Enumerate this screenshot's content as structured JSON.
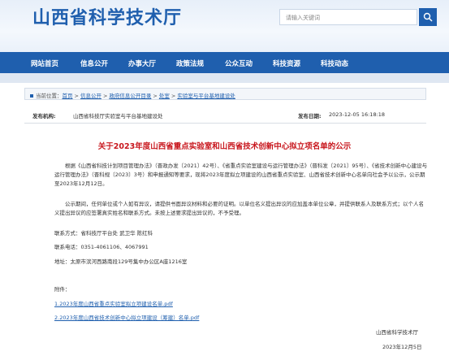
{
  "site": {
    "title": "山西省科学技术厅"
  },
  "search": {
    "placeholder": "请输入关键词"
  },
  "nav": {
    "items": [
      "网站首页",
      "信息公开",
      "办事大厅",
      "政策法规",
      "公众互动",
      "科技资源",
      "科技动态"
    ]
  },
  "breadcrumb": {
    "prefix": "当前位置：",
    "items": [
      "首页",
      "信息公开",
      "政府信息公开目录",
      "处室",
      "实验室与平台基地建设处"
    ]
  },
  "meta": {
    "agency_label": "发布机构:",
    "agency_value": "山西省科技厅实验室与平台基地建设处",
    "date_label": "发布日期:",
    "date_value": "2023-12-05 16:18:18"
  },
  "article": {
    "title": "关于2023年度山西省重点实验室和山西省技术创新中心拟立项名单的公示",
    "paragraph1": "根据《山西省科技计划项目管理办法》（晋政办发〔2021〕42号）、《省重点实验室建设与运行管理办法》（晋科发〔2021〕95号）、《省技术创新中心建设与运行管理办法》（晋科规〔2023〕3号）和申报通知等要求，现将2023年度拟立项建设的山西省重点实验室、山西省技术创新中心名单向社会予以公示，公示期至2023年12月12日。",
    "paragraph2": "公示期间，任何单位或个人如有异议，请提供书面异议材料和必要的证明。以单位名义提出异议的应加盖本单位公章，并提供联系人及联系方式；以个人名义提出异议的应签署真实姓名和联系方式。未按上述要求提出异议的，不予受理。",
    "contact_unit": "联系方式：省科技厅平台处   武卫华   陈红科",
    "contact_phone": "联系电话：0351-4061106、4067991",
    "contact_address": "地址：太原市滨河西路南段129号集中办公区A座1216室",
    "attachments_label": "附件：",
    "attachments": [
      "1.2023年度山西省重点实验室拟立项建设名单.pdf",
      "2.2023年度山西省技术创新中心拟立项建设（筹建）名单.pdf"
    ],
    "signature": "山西省科学技术厅",
    "sign_date": "2023年12月5日"
  },
  "colors": {
    "brand": "#1f5fae",
    "title_red": "#c8161d"
  }
}
